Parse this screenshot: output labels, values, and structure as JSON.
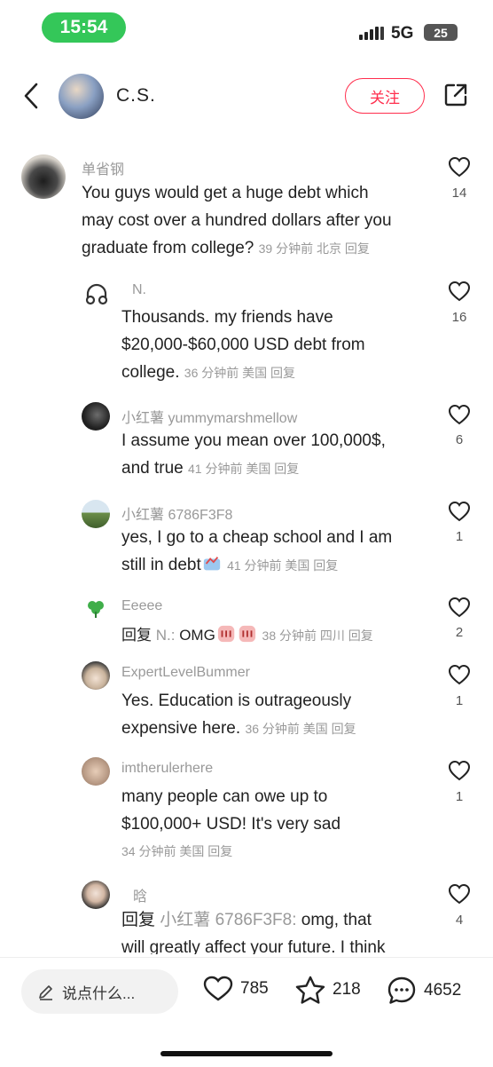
{
  "status": {
    "time": "15:54",
    "network": "5G",
    "battery": "25"
  },
  "header": {
    "name": "C.S.",
    "follow_label": "关注"
  },
  "comments": [
    {
      "user": "单省钢",
      "lines": [
        "You guys would get a huge debt which",
        "may cost over a hundred dollars after you",
        "graduate from college?"
      ],
      "meta": "39 分钟前 北京 回复",
      "likes": "14"
    },
    {
      "user": "N.",
      "lines": [
        "Thousands. my friends have",
        "$20,000-$60,000 USD debt from",
        "college."
      ],
      "meta": "36 分钟前 美国 回复",
      "likes": "16"
    },
    {
      "user": "小红薯 yummymarshmellow",
      "lines": [
        "I assume you mean over 100,000$,",
        "and true"
      ],
      "meta": "41 分钟前 美国 回复",
      "likes": "6"
    },
    {
      "user": "小红薯 6786F3F8",
      "lines": [
        "yes, I go to a cheap school and I am",
        "still in debt"
      ],
      "meta": "41 分钟前 美国 回复",
      "likes": "1"
    },
    {
      "user": "Eeeee",
      "reply_prefix": "回复",
      "reply_target": "N.:",
      "lines": [
        "OMG"
      ],
      "meta": "38 分钟前 四川 回复",
      "likes": "2"
    },
    {
      "user": "ExpertLevelBummer",
      "lines": [
        "Yes. Education is outrageously",
        "expensive here."
      ],
      "meta": "36 分钟前 美国 回复",
      "likes": "1"
    },
    {
      "user": "imtherulerhere",
      "lines": [
        "many people can owe up to",
        "$100,000+ USD! It's very sad"
      ],
      "meta": "34 分钟前 美国 回复",
      "likes": "1"
    },
    {
      "user": "晗",
      "reply_prefix": "回复",
      "reply_target": "小红薯 6786F3F8:",
      "lines": [
        "omg, that",
        "will greatly affect your future. I think"
      ],
      "likes": "4"
    }
  ],
  "bottom": {
    "placeholder": "说点什么...",
    "likes": "785",
    "stars": "218",
    "comments": "4652"
  },
  "colors": {
    "accent": "#ff2e4d",
    "status_green": "#34c759"
  }
}
